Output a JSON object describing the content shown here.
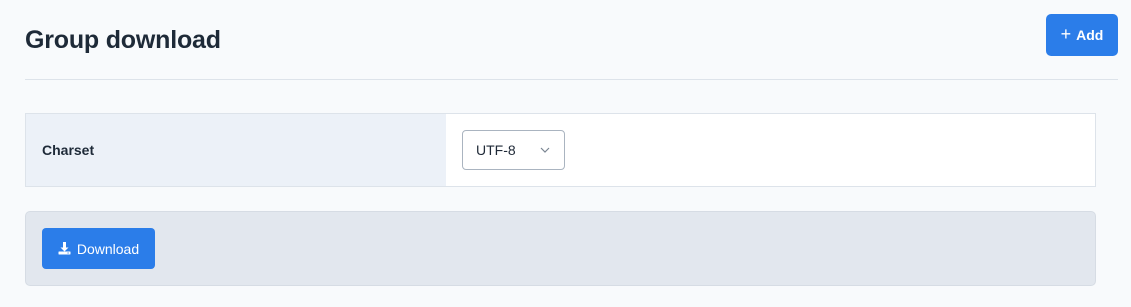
{
  "header": {
    "title": "Group download",
    "add_label": "Add",
    "add_icon": "plus-icon"
  },
  "form": {
    "charset_label": "Charset",
    "charset_value": "UTF-8",
    "select_icon": "chevron-down-icon"
  },
  "actions": {
    "download_label": "Download",
    "download_icon": "download-icon"
  },
  "colors": {
    "primary": "#2b7de9",
    "label_cell_bg": "#ecf1f8",
    "panel_bg": "#e2e7ee"
  }
}
